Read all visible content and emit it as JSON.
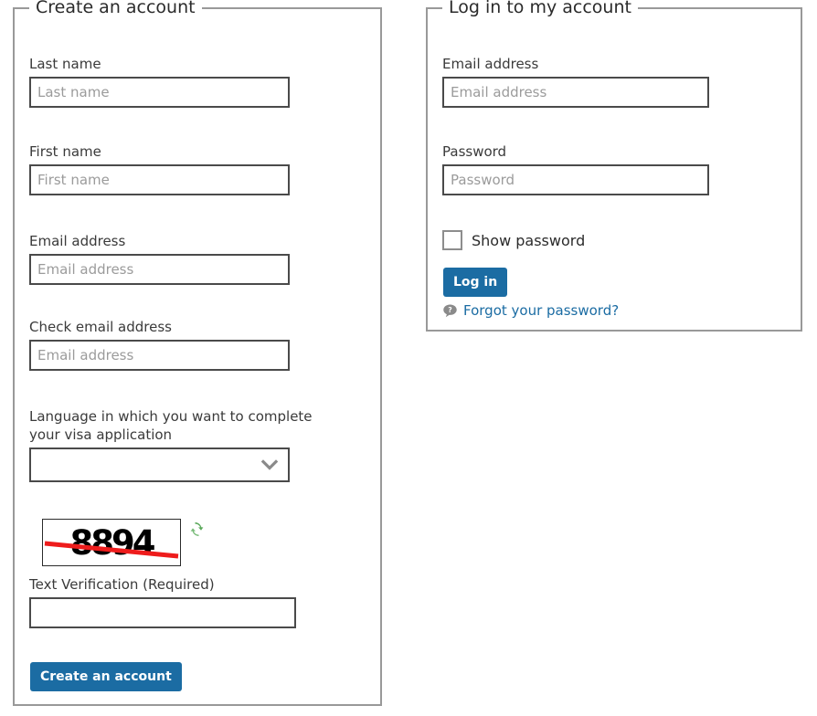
{
  "create_panel": {
    "legend": "Create an account",
    "fields": {
      "last_name": {
        "label": "Last name",
        "value": "",
        "placeholder": "Last name"
      },
      "first_name": {
        "label": "First name",
        "value": "",
        "placeholder": "First name"
      },
      "email": {
        "label": "Email address",
        "value": "",
        "placeholder": "Email address"
      },
      "check_email": {
        "label": "Check email address",
        "value": "",
        "placeholder": "Email address"
      },
      "language": {
        "label": "Language in which you want to complete your visa application",
        "selected": ""
      },
      "text_verification": {
        "label": "Text Verification (Required)",
        "value": "",
        "placeholder": ""
      }
    },
    "captcha": {
      "code": "8894",
      "refresh_icon": "refresh-icon",
      "strike_color": "#ee1c1c"
    },
    "submit_label": "Create an account"
  },
  "login_panel": {
    "legend": "Log in to my account",
    "fields": {
      "email": {
        "label": "Email address",
        "value": "",
        "placeholder": "Email address"
      },
      "password": {
        "label": "Password",
        "value": "",
        "placeholder": "Password"
      }
    },
    "show_password_label": "Show password",
    "show_password_checked": false,
    "submit_label": "Log in",
    "forgot_link": "Forgot your password?",
    "help_icon": "help-question-icon"
  },
  "colors": {
    "accent": "#1b6ca3",
    "panel_border": "#999999",
    "input_border": "#4a4a4a",
    "placeholder": "#9b9b9b",
    "label": "#3a3a3a",
    "captcha_strike": "#ee1c1c",
    "refresh_icon": "#5aa85a"
  }
}
